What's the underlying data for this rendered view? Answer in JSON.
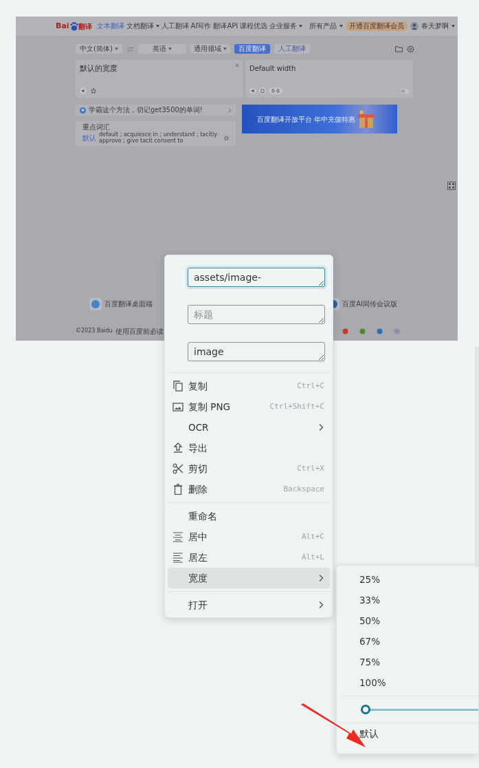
{
  "document_image": {
    "header": {
      "logo": {
        "left": "Bai",
        "right": "翻译"
      },
      "nav": [
        {
          "label": "文本翻译",
          "selected": true
        },
        {
          "label": "文档翻译",
          "selected": false,
          "dropdown": true
        },
        {
          "label": "人工翻译",
          "selected": false
        },
        {
          "label": "AI写作",
          "selected": false
        },
        {
          "label": "翻译API",
          "selected": false
        },
        {
          "label": "课程优选",
          "selected": false
        },
        {
          "label": "企业服务",
          "selected": false,
          "dropdown": true
        }
      ],
      "products": "所有产品",
      "member_button": "开通百度翻译会员",
      "user": "春天梦啊"
    },
    "toolbar": {
      "source_language": "中文(简体)",
      "target_language": "英语",
      "domain": "通用领域",
      "translate_button": "百度翻译",
      "human_button": "人工翻译"
    },
    "input": {
      "text": "默认的宽度"
    },
    "output": {
      "text": "Default width"
    },
    "tip": "学霸这个方法，切记get3500的单词!",
    "dictionary": {
      "title": "重点词汇",
      "tag": "默认",
      "definition": "default ; acquiesce in ; understand ; tacitly approve ; give tacit consent to"
    },
    "ad_banner": {
      "title": "百度翻译开放平台 年中充值特惠"
    },
    "apps": [
      {
        "name": "百度翻译桌面端"
      },
      {
        "name": "百度AI同传会议版"
      }
    ],
    "footer": [
      "©2023 Baidu",
      "使用百度前必读"
    ]
  },
  "context_menu": {
    "fields": [
      {
        "value": "assets/image-",
        "focused": true
      },
      {
        "placeholder": "标题",
        "focused": false
      },
      {
        "value": "image",
        "focused": false
      }
    ],
    "groups": [
      [
        {
          "label": "复制",
          "kind": "copy",
          "shortcut": "Ctrl+C",
          "selected": false
        },
        {
          "label": "复制 PNG",
          "kind": "image",
          "shortcut": "Ctrl+Shift+C",
          "selected": false
        },
        {
          "label": "OCR",
          "submenu": true,
          "selected": false
        },
        {
          "label": "导出",
          "kind": "upload",
          "selected": false
        },
        {
          "label": "剪切",
          "kind": "scissors",
          "shortcut": "Ctrl+X",
          "selected": false
        },
        {
          "label": "删除",
          "kind": "trash",
          "shortcut": "Backspace",
          "selected": false
        }
      ],
      [
        {
          "label": "重命名",
          "selected": false
        },
        {
          "label": "居中",
          "kind": "align-center",
          "shortcut": "Alt+C",
          "selected": false
        },
        {
          "label": "居左",
          "kind": "align-left",
          "shortcut": "Alt+L",
          "selected": false
        },
        {
          "label": "宽度",
          "submenu": true,
          "selected": true
        }
      ],
      [
        {
          "label": "打开",
          "submenu": true,
          "selected": false
        }
      ]
    ]
  },
  "width_submenu": {
    "options": [
      "25%",
      "33%",
      "50%",
      "67%",
      "75%",
      "100%"
    ],
    "slider": {
      "level": 0
    },
    "default_option": "默认"
  }
}
